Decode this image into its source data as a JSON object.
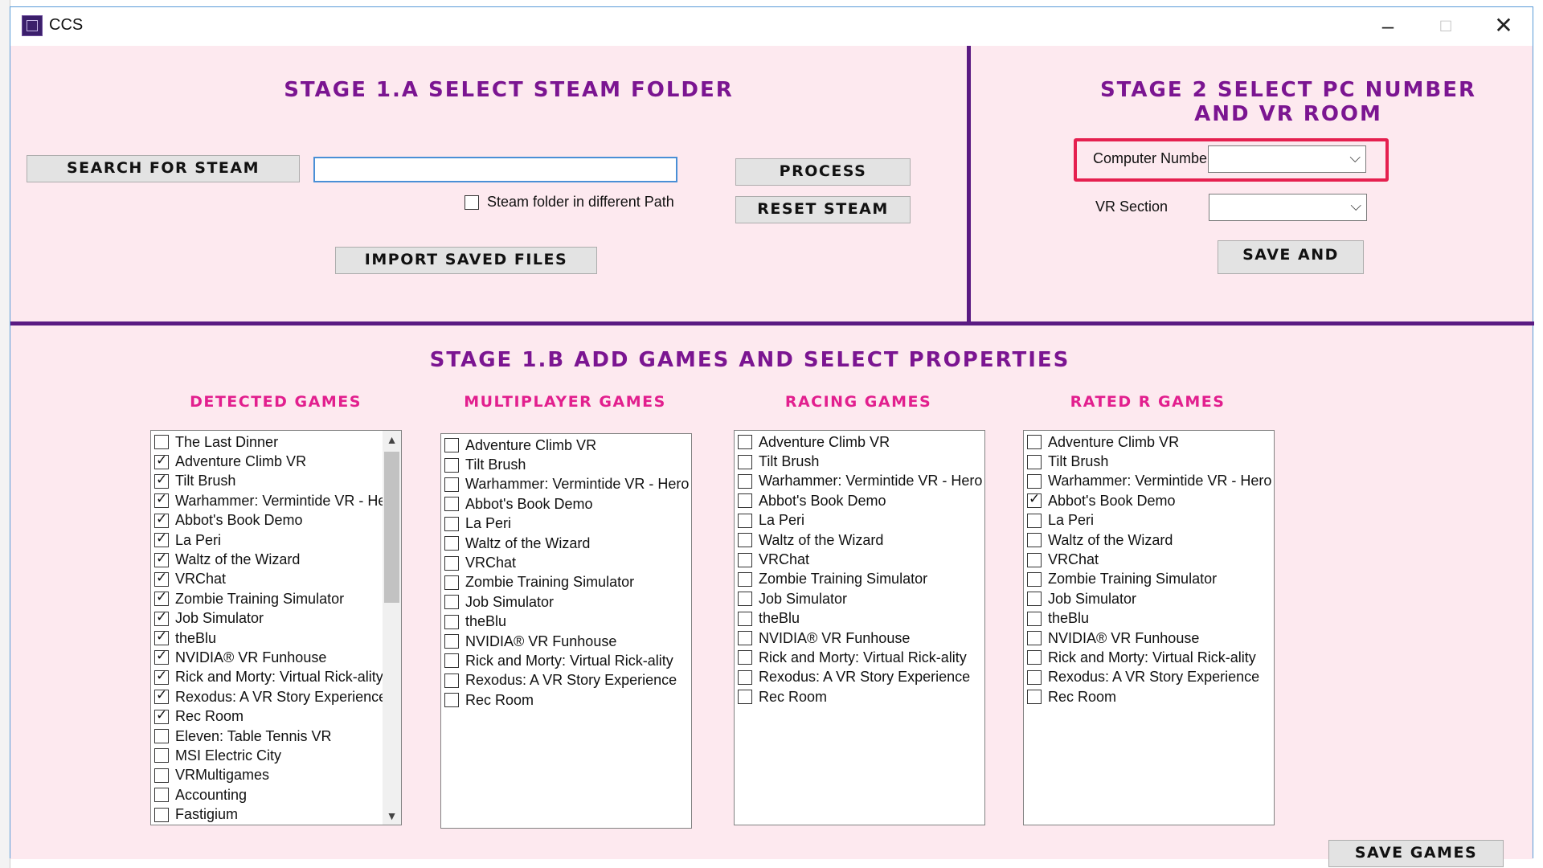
{
  "window": {
    "title": "CCS"
  },
  "stage1a": {
    "title": "STAGE 1.A SELECT STEAM FOLDER",
    "search_button": "SEARCH FOR STEAM",
    "path_value": "",
    "diff_path_checkbox": "Steam folder in different Path",
    "diff_path_checked": false,
    "import_button": "IMPORT SAVED FILES",
    "process_button": "PROCESS",
    "reset_button": "RESET STEAM"
  },
  "stage2": {
    "title_line1": "STAGE 2 SELECT PC NUMBER",
    "title_line2": "AND VR ROOM",
    "computer_number_label": "Computer Number",
    "computer_number_value": "",
    "vr_section_label": "VR Section",
    "vr_section_value": "",
    "save_button": "SAVE AND",
    "highlight_color": "#e5204f"
  },
  "stage1b": {
    "title": "STAGE 1.B  ADD GAMES AND SELECT PROPERTIES",
    "save_games_button": "SAVE GAMES",
    "columns": [
      {
        "title": "DETECTED GAMES",
        "scrollable": true,
        "items": [
          {
            "label": "The Last Dinner",
            "checked": false
          },
          {
            "label": "Adventure Climb VR",
            "checked": true
          },
          {
            "label": "Tilt Brush",
            "checked": true
          },
          {
            "label": "Warhammer: Vermintide VR - He",
            "checked": true
          },
          {
            "label": "Abbot's Book Demo",
            "checked": true
          },
          {
            "label": "La Peri",
            "checked": true
          },
          {
            "label": "Waltz of the Wizard",
            "checked": true
          },
          {
            "label": "VRChat",
            "checked": true
          },
          {
            "label": "Zombie Training Simulator",
            "checked": true
          },
          {
            "label": "Job Simulator",
            "checked": true
          },
          {
            "label": "theBlu",
            "checked": true
          },
          {
            "label": "NVIDIA® VR Funhouse",
            "checked": true
          },
          {
            "label": "Rick and Morty: Virtual Rick-ality",
            "checked": true
          },
          {
            "label": "Rexodus: A VR Story Experience",
            "checked": true
          },
          {
            "label": "Rec Room",
            "checked": true
          },
          {
            "label": "Eleven: Table Tennis VR",
            "checked": false
          },
          {
            "label": "MSI Electric City",
            "checked": false
          },
          {
            "label": "VRMultigames",
            "checked": false
          },
          {
            "label": "Accounting",
            "checked": false
          },
          {
            "label": "Fastigium",
            "checked": false
          }
        ]
      },
      {
        "title": "MULTIPLAYER GAMES",
        "scrollable": false,
        "items": [
          {
            "label": "Adventure Climb VR",
            "checked": false
          },
          {
            "label": "Tilt Brush",
            "checked": false
          },
          {
            "label": "Warhammer: Vermintide VR - Hero T",
            "checked": false
          },
          {
            "label": "Abbot's Book Demo",
            "checked": false
          },
          {
            "label": "La Peri",
            "checked": false
          },
          {
            "label": "Waltz of the Wizard",
            "checked": false
          },
          {
            "label": "VRChat",
            "checked": false
          },
          {
            "label": "Zombie Training Simulator",
            "checked": false
          },
          {
            "label": "Job Simulator",
            "checked": false
          },
          {
            "label": "theBlu",
            "checked": false
          },
          {
            "label": "NVIDIA® VR Funhouse",
            "checked": false
          },
          {
            "label": "Rick and Morty: Virtual Rick-ality",
            "checked": false
          },
          {
            "label": "Rexodus: A VR Story Experience",
            "checked": false
          },
          {
            "label": "Rec Room",
            "checked": false
          }
        ]
      },
      {
        "title": "RACING GAMES",
        "scrollable": false,
        "items": [
          {
            "label": "Adventure Climb VR",
            "checked": false
          },
          {
            "label": "Tilt Brush",
            "checked": false
          },
          {
            "label": "Warhammer: Vermintide VR - Hero T",
            "checked": false
          },
          {
            "label": "Abbot's Book Demo",
            "checked": false
          },
          {
            "label": "La Peri",
            "checked": false
          },
          {
            "label": "Waltz of the Wizard",
            "checked": false
          },
          {
            "label": "VRChat",
            "checked": false
          },
          {
            "label": "Zombie Training Simulator",
            "checked": false
          },
          {
            "label": "Job Simulator",
            "checked": false
          },
          {
            "label": "theBlu",
            "checked": false
          },
          {
            "label": "NVIDIA® VR Funhouse",
            "checked": false
          },
          {
            "label": "Rick and Morty: Virtual Rick-ality",
            "checked": false
          },
          {
            "label": "Rexodus: A VR Story Experience",
            "checked": false
          },
          {
            "label": "Rec Room",
            "checked": false
          }
        ]
      },
      {
        "title": "RATED R GAMES",
        "scrollable": false,
        "items": [
          {
            "label": "Adventure Climb VR",
            "checked": false
          },
          {
            "label": "Tilt Brush",
            "checked": false
          },
          {
            "label": "Warhammer: Vermintide VR - Hero T",
            "checked": false
          },
          {
            "label": "Abbot's Book Demo",
            "checked": true
          },
          {
            "label": "La Peri",
            "checked": false
          },
          {
            "label": "Waltz of the Wizard",
            "checked": false
          },
          {
            "label": "VRChat",
            "checked": false
          },
          {
            "label": "Zombie Training Simulator",
            "checked": false
          },
          {
            "label": "Job Simulator",
            "checked": false
          },
          {
            "label": "theBlu",
            "checked": false
          },
          {
            "label": "NVIDIA® VR Funhouse",
            "checked": false
          },
          {
            "label": "Rick and Morty: Virtual Rick-ality",
            "checked": false
          },
          {
            "label": "Rexodus: A VR Story Experience",
            "checked": false
          },
          {
            "label": "Rec Room",
            "checked": false
          }
        ]
      }
    ]
  },
  "colors": {
    "stage_title": "#7b1591",
    "column_title": "#e21f8e",
    "divider": "#5a1a82",
    "background": "#fde9ef"
  }
}
